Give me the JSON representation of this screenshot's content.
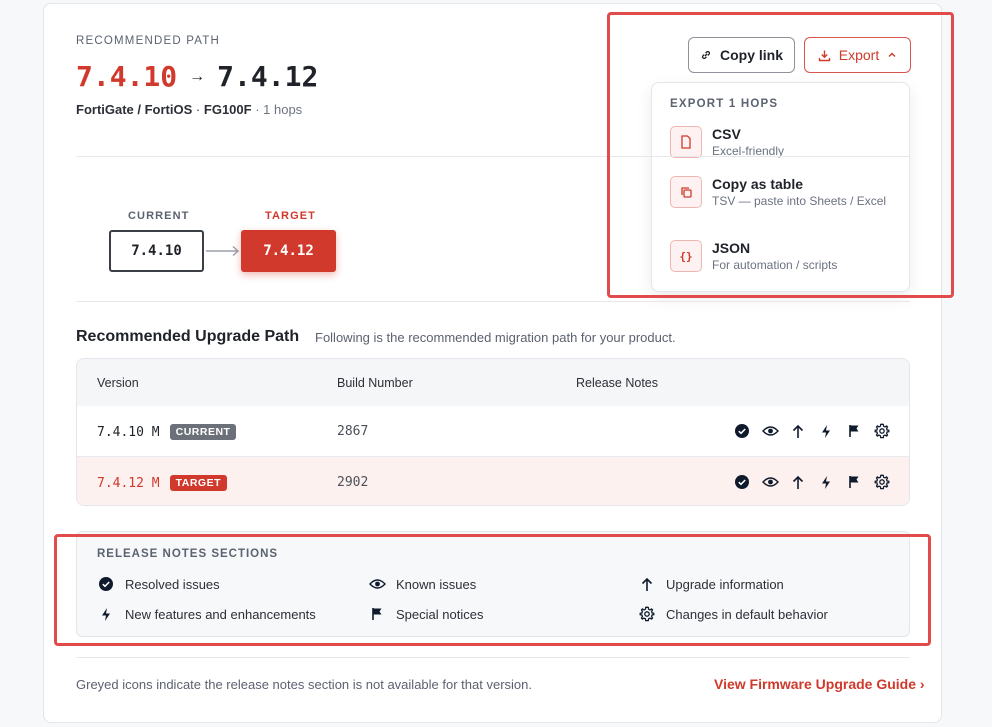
{
  "header": {
    "eyebrow": "RECOMMENDED PATH",
    "from_version": "7.4.10",
    "arrow": "→",
    "to_version": "7.4.12",
    "product": "FortiGate / FortiOS",
    "dot": "·",
    "model": "FG100F",
    "hops": "· 1 hops"
  },
  "toolbar": {
    "copy_link_label": "Copy link",
    "export_label": "Export"
  },
  "export_menu": {
    "heading": "EXPORT 1 HOPS",
    "items": [
      {
        "title": "CSV",
        "subtitle": "Excel-friendly",
        "icon": "file-icon"
      },
      {
        "title": "Copy as table",
        "subtitle": "TSV — paste into Sheets / Excel",
        "icon": "copy-icon"
      },
      {
        "title": "JSON",
        "subtitle": "For automation / scripts",
        "icon": "braces-icon",
        "glyph": "{}"
      }
    ]
  },
  "flow": {
    "current_label": "CURRENT",
    "current_version": "7.4.10",
    "target_label": "TARGET",
    "target_version": "7.4.12"
  },
  "upgrade_path": {
    "title": "Recommended Upgrade Path",
    "description": "Following is the recommended migration path for your product.",
    "columns": [
      "Version",
      "Build Number",
      "Release Notes"
    ],
    "rows": [
      {
        "version": "7.4.10 M",
        "badge": "CURRENT",
        "build": "2867"
      },
      {
        "version": "7.4.12 M",
        "badge": "TARGET",
        "build": "2902"
      }
    ]
  },
  "legend": {
    "heading": "RELEASE NOTES SECTIONS",
    "items": [
      {
        "label": "Resolved issues",
        "icon": "check-circle-icon"
      },
      {
        "label": "Known issues",
        "icon": "eye-icon"
      },
      {
        "label": "Upgrade information",
        "icon": "arrow-up-icon"
      },
      {
        "label": "New features and enhancements",
        "icon": "bolt-icon"
      },
      {
        "label": "Special notices",
        "icon": "flag-icon"
      },
      {
        "label": "Changes in default behavior",
        "icon": "gear-icon"
      }
    ]
  },
  "footer": {
    "note": "Greyed icons indicate the release notes section is not available for that version.",
    "link": "View Firmware Upgrade Guide ›"
  },
  "colors": {
    "accent": "#d0392b",
    "current_badge": "#6b7079",
    "target_badge": "#d0392b",
    "highlight": "#e14b4b"
  }
}
